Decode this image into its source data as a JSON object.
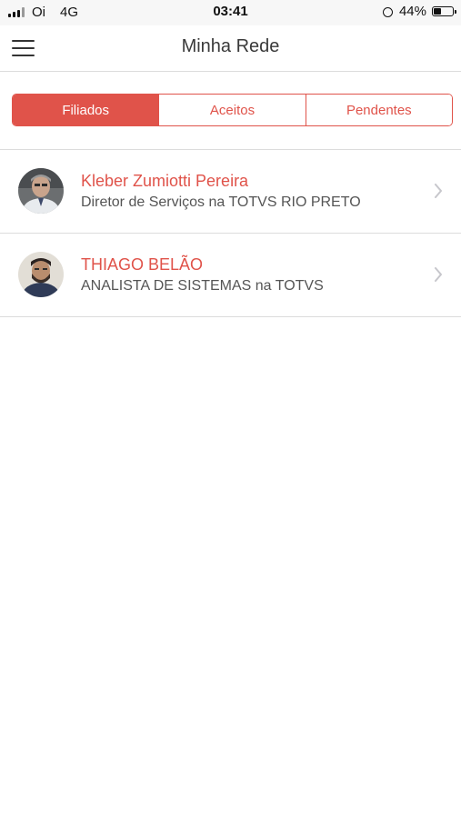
{
  "status_bar": {
    "carrier": "Oi",
    "network": "4G",
    "time": "03:41",
    "battery": "44%",
    "battery_level": 0.44,
    "signal_bars": 3,
    "icons": [
      "signal-icon",
      "alarm-icon",
      "battery-icon"
    ]
  },
  "nav": {
    "title": "Minha Rede",
    "menu_icon": "hamburger-menu-icon"
  },
  "tabs": {
    "selected": "Filiados",
    "items": [
      {
        "label": "Filiados"
      },
      {
        "label": "Aceitos"
      },
      {
        "label": "Pendentes"
      }
    ]
  },
  "contacts": [
    {
      "name": "Kleber Zumiotti Pereira",
      "role": "Diretor de Serviços na TOTVS RIO PRETO",
      "avatar_icon": "avatar-photo"
    },
    {
      "name": "THIAGO BELÃO",
      "role": "ANALISTA DE SISTEMAS na TOTVS",
      "avatar_icon": "avatar-photo"
    }
  ],
  "colors": {
    "accent": "#e0534a",
    "divider": "#dcdcdc",
    "status_bar_bg": "#f7f7f7"
  }
}
